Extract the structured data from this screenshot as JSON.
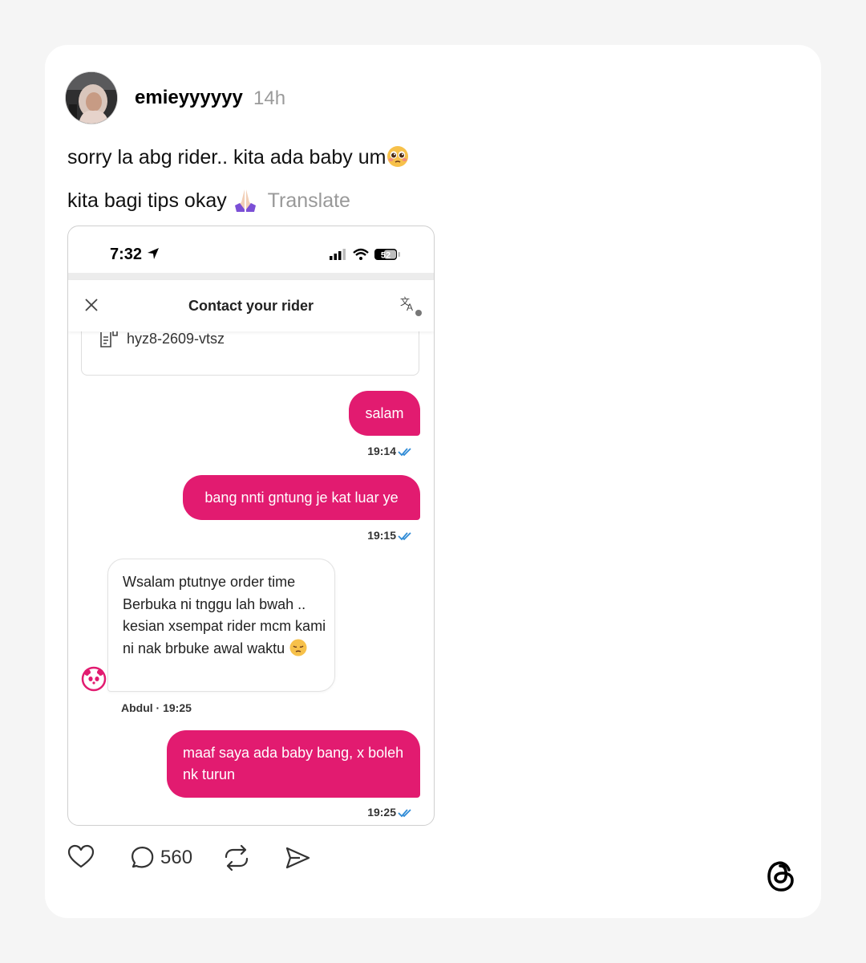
{
  "post": {
    "username": "emieyyyyyy",
    "time_ago": "14h",
    "line1": "sorry la abg rider.. kita ada baby um",
    "line2": "kita bagi tips okay",
    "translate": "Translate",
    "reply_count": "560"
  },
  "screenshot": {
    "status_time": "7:32",
    "battery": "52",
    "header_title": "Contact your rider",
    "order_code": "hyz8-2609-vtsz",
    "messages": [
      {
        "direction": "out",
        "text": "salam",
        "time": "19:14"
      },
      {
        "direction": "out",
        "text": "bang nnti gntung je kat luar ye",
        "time": "19:15"
      },
      {
        "direction": "in",
        "text": "Wsalam ptutnye order time Berbuka ni tnggu lah bwah .. kesian xsempat rider mcm kami ni nak brbuke awal waktu",
        "sender": "Abdul · 19:25"
      },
      {
        "direction": "out",
        "text": "maaf saya ada baby bang, x boleh nk turun",
        "time": "19:25"
      }
    ]
  },
  "colors": {
    "accent_pink": "#e21b70",
    "read_tick_blue": "#2f8bd6",
    "card_bg": "#ffffff",
    "page_bg": "#f5f5f5"
  },
  "icons": {
    "emoji_line1": "pleading-face-icon",
    "emoji_line2": "folded-hands-icon",
    "emoji_message": "pensive-face-icon",
    "actions": [
      "heart-icon",
      "comment-icon",
      "repost-icon",
      "share-icon"
    ],
    "brand": "threads-logo-icon"
  }
}
